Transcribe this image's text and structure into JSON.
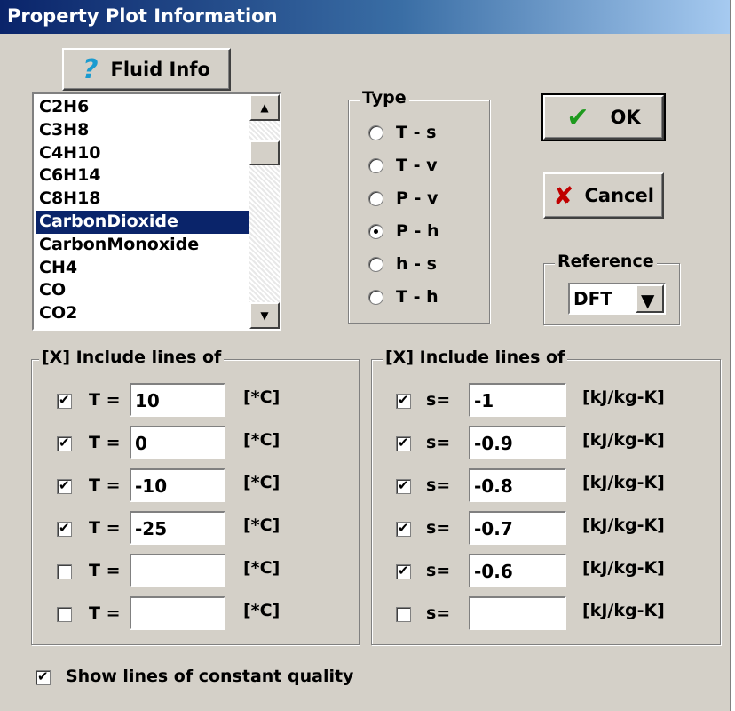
{
  "window": {
    "title": "Property Plot Information"
  },
  "buttons": {
    "fluid_info": "Fluid Info",
    "ok": "OK",
    "cancel": "Cancel"
  },
  "fluids": {
    "items": [
      "C2H6",
      "C3H8",
      "C4H10",
      "C6H14",
      "C8H18",
      "CarbonDioxide",
      "CarbonMonoxide",
      "CH4",
      "CO",
      "CO2"
    ],
    "selected": "CarbonDioxide"
  },
  "type_group": {
    "legend": "Type",
    "options": [
      "T - s",
      "T - v",
      "P - v",
      "P - h",
      "h - s",
      "T - h"
    ],
    "selected": "P - h"
  },
  "reference": {
    "legend": "Reference",
    "value": "DFT"
  },
  "temperature_lines": {
    "legend": "[X] Include lines of",
    "rows": [
      {
        "label": "T =",
        "value": "10",
        "unit": "[*C]",
        "checked": true
      },
      {
        "label": "T =",
        "value": "0",
        "unit": "[*C]",
        "checked": true
      },
      {
        "label": "T =",
        "value": "-10",
        "unit": "[*C]",
        "checked": true
      },
      {
        "label": "T =",
        "value": "-25",
        "unit": "[*C]",
        "checked": true
      },
      {
        "label": "T =",
        "value": "",
        "unit": "[*C]",
        "checked": false
      },
      {
        "label": "T =",
        "value": "",
        "unit": "[*C]",
        "checked": false
      }
    ]
  },
  "entropy_lines": {
    "legend": "[X] Include lines of",
    "rows": [
      {
        "label": "s=",
        "value": "-1",
        "unit": "[kJ/kg-K]",
        "checked": true
      },
      {
        "label": "s=",
        "value": "-0.9",
        "unit": "[kJ/kg-K]",
        "checked": true
      },
      {
        "label": "s=",
        "value": "-0.8",
        "unit": "[kJ/kg-K]",
        "checked": true
      },
      {
        "label": "s=",
        "value": "-0.7",
        "unit": "[kJ/kg-K]",
        "checked": true
      },
      {
        "label": "s=",
        "value": "-0.6",
        "unit": "[kJ/kg-K]",
        "checked": true
      },
      {
        "label": "s=",
        "value": "",
        "unit": "[kJ/kg-K]",
        "checked": false
      }
    ]
  },
  "quality": {
    "label": "Show lines of constant quality",
    "checked": true
  },
  "colors": {
    "title_start": "#0a246a",
    "title_end": "#a6caf0",
    "face": "#d4d0c8",
    "selection": "#0a246a",
    "ok_check": "#1e9a1e",
    "cancel_x": "#c00000",
    "help_icon": "#1a9bd0"
  }
}
